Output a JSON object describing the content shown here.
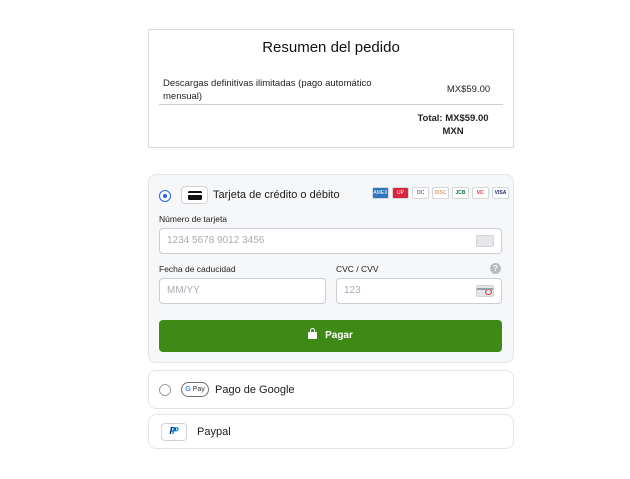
{
  "summary": {
    "title": "Resumen del pedido",
    "item_name": "Descargas definitivas ilimitadas (pago automático mensual)",
    "item_price": "MX$59.00",
    "total": "Total: MX$59.00 MXN"
  },
  "card": {
    "label": "Tarjeta de crédito o débito",
    "selected": true,
    "brands": [
      "amex",
      "unionpay",
      "diners",
      "discover",
      "jcb",
      "mastercard",
      "visa"
    ],
    "brand_labels": {
      "amex": "AMEX",
      "unionpay": "UP",
      "diners": "DC",
      "discover": "DISC",
      "jcb": "JCB",
      "mastercard": "MC",
      "visa": "VISA"
    },
    "number_label": "Número de tarjeta",
    "number_placeholder": "1234 5678 9012 3456",
    "expiry_label": "Fecha de caducidad",
    "expiry_placeholder": "MM/YY",
    "cvc_label": "CVC / CVV",
    "cvc_placeholder": "123",
    "help_glyph": "?",
    "pay_label": "Pagar",
    "pay_color": "#3d8a16",
    "accent_color": "#2563eb"
  },
  "google_pay": {
    "label": "Pago de Google",
    "logo_g": "G",
    "logo_pay": " Pay",
    "selected": false
  },
  "paypal": {
    "label": "Paypal",
    "logo_p1": "P",
    "logo_p2": "P"
  }
}
